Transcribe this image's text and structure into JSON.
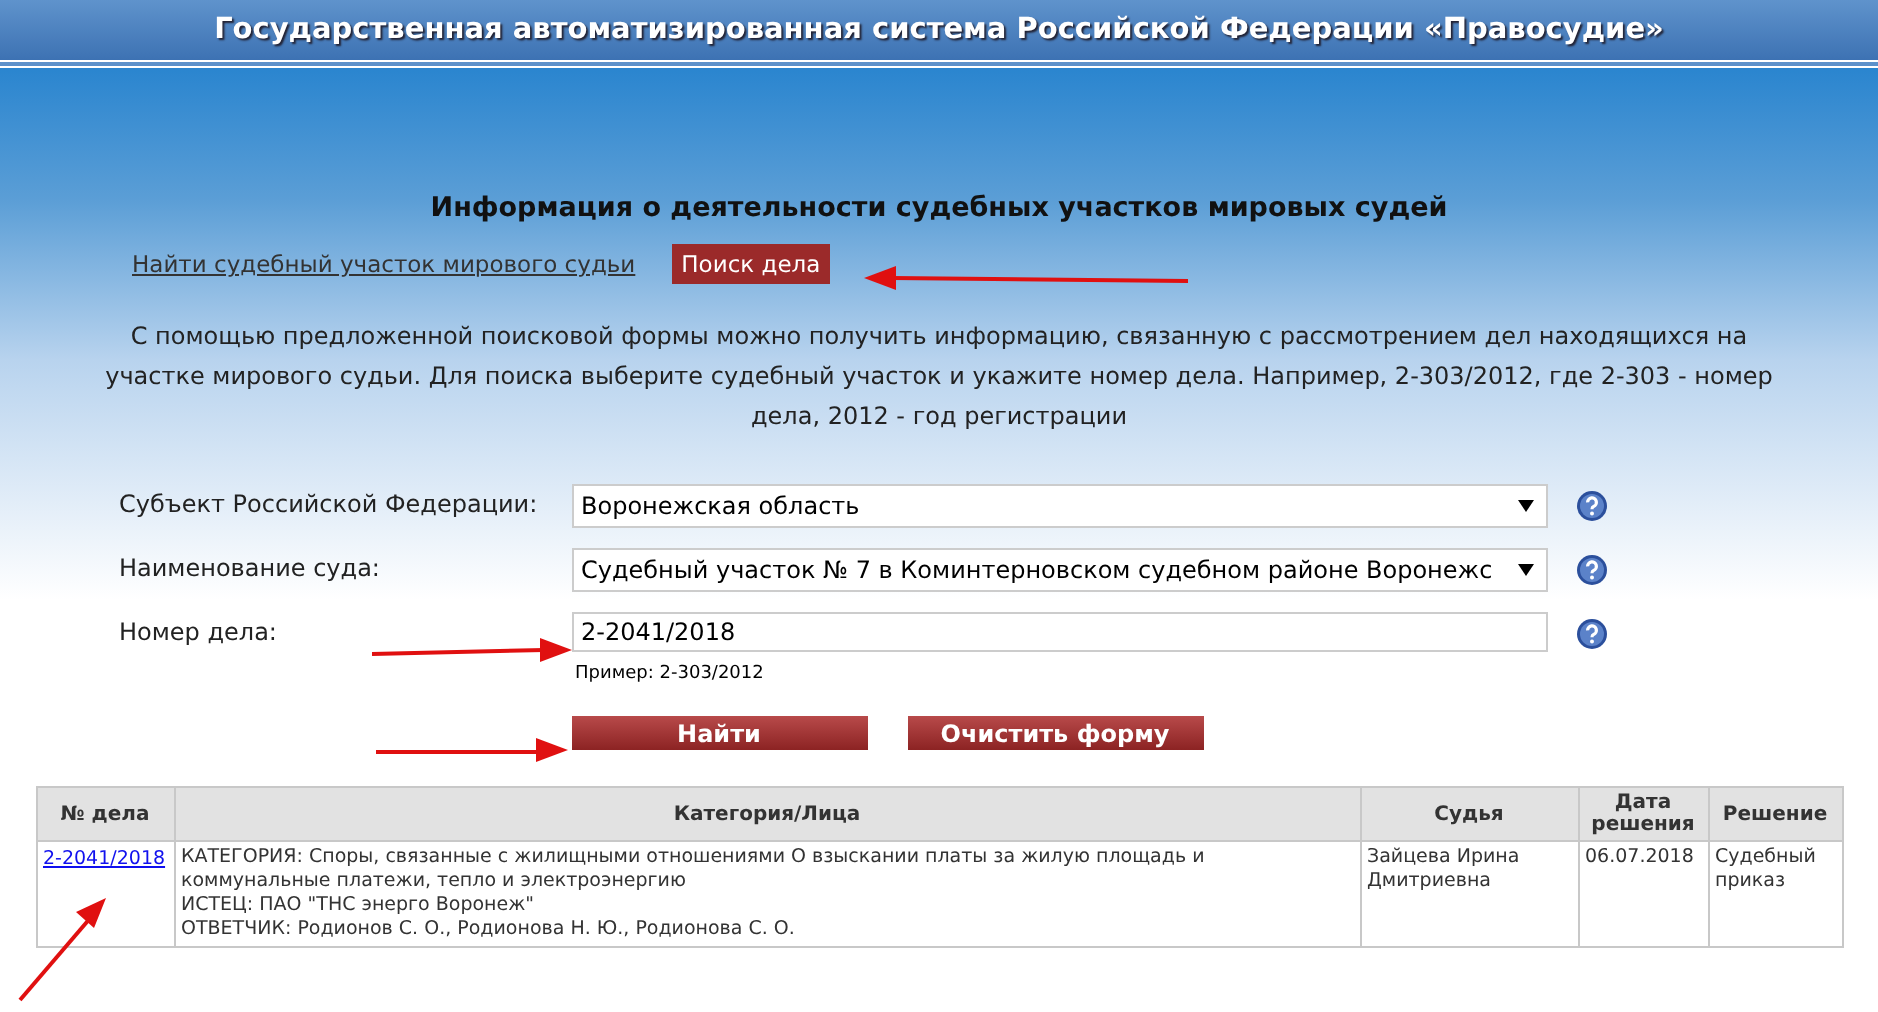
{
  "header": {
    "title": "Государственная автоматизированная система Российской Федерации «Правосудие»"
  },
  "page_title": "Информация о деятельности судебных участков мировых судей",
  "tabs": [
    {
      "label": "Найти судебный участок мирового судьи",
      "selected": false
    },
    {
      "label": "Поиск дела",
      "selected": true
    }
  ],
  "description": "С помощью предложенной поисковой формы можно получить информацию, связанную с рассмотрением дел находящихся на участке мирового судьи. Для поиска выберите судебный участок и укажите номер дела. Например, 2-303/2012, где 2-303 - номер дела, 2012 - год регистрации",
  "form": {
    "fields": [
      {
        "kind": "select",
        "label": "Субъект Российской Федерации:",
        "value": "Воронежская область"
      },
      {
        "kind": "select",
        "label": "Наименование суда:",
        "value": "Судебный участок № 7 в Коминтерновском судебном районе Воронежс"
      },
      {
        "kind": "input",
        "label": "Номер дела:",
        "value": "2-2041/2018",
        "hint": "Пример: 2-303/2012"
      }
    ],
    "buttons": [
      "Найти",
      "Очистить форму"
    ]
  },
  "table": {
    "columns": [
      "№ дела",
      "Категория/Лица",
      "Судья",
      "Дата решения",
      "Решение"
    ],
    "rows": [
      {
        "case": "2-2041/2018",
        "details": [
          "КАТЕГОРИЯ: Споры, связанные с жилищными отношениями О взыскании платы за жилую площадь и коммунальные платежи, тепло и электроэнергию",
          "ИСТЕЦ: ПАО \"ТНС энерго Воронеж\"",
          "ОТВЕТЧИК: Родионов С. О., Родионова Н. Ю., Родионова С. О."
        ],
        "judge": "Зайцева Ирина Дмитриевна",
        "date": "06.07.2018",
        "decision": "Судебный приказ"
      }
    ]
  }
}
